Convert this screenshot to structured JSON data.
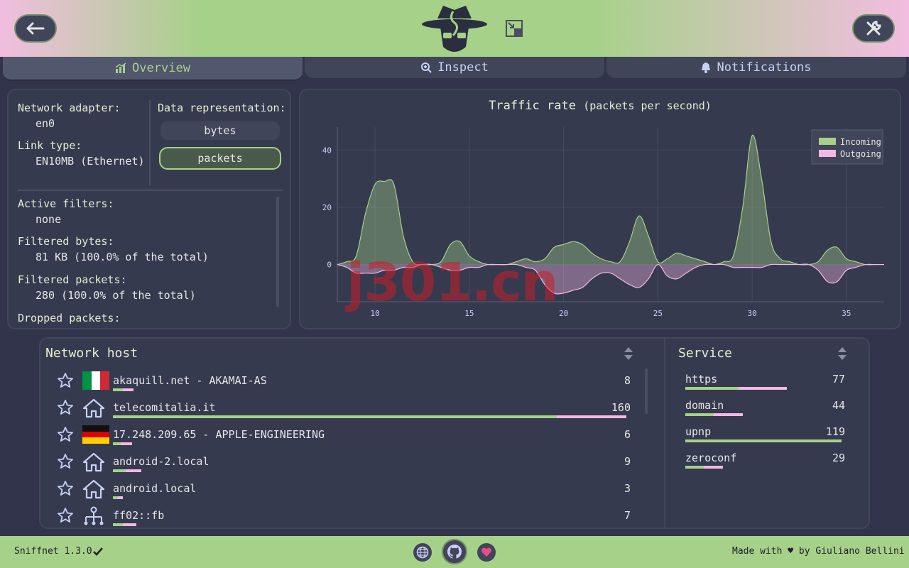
{
  "tabs": [
    {
      "label": "Overview",
      "active": true
    },
    {
      "label": "Inspect",
      "active": false
    },
    {
      "label": "Notifications",
      "active": false
    }
  ],
  "info": {
    "adapter_label": "Network adapter:",
    "adapter_value": "en0",
    "link_label": "Link type:",
    "link_value": "EN10MB (Ethernet)",
    "rep_label": "Data representation:",
    "rep_options": [
      "bytes",
      "packets"
    ],
    "rep_selected": "packets",
    "filters_label": "Active filters:",
    "filters_value": "none",
    "fbytes_label": "Filtered bytes:",
    "fbytes_value": "81 KB (100.0% of the total)",
    "fpackets_label": "Filtered packets:",
    "fpackets_value": "280 (100.0% of the total)",
    "dropped_label": "Dropped packets:"
  },
  "chart_title": "Traffic rate",
  "chart_subtitle": "(packets per second)",
  "chart_data": {
    "type": "area",
    "title": "Traffic rate (packets per second)",
    "x_ticks": [
      10,
      15,
      20,
      25,
      30,
      35
    ],
    "y_ticks": [
      0,
      20,
      40
    ],
    "xlim": [
      8,
      37
    ],
    "ylim": [
      -13,
      48
    ],
    "legend_position": "top-right",
    "series": [
      {
        "name": "Incoming",
        "color": "#a6d189",
        "x": [
          8,
          8.5,
          9,
          9.5,
          10,
          10.5,
          11,
          11.5,
          12,
          12.5,
          13,
          13.5,
          14,
          14.5,
          15,
          15.5,
          16,
          16.5,
          17,
          17.5,
          18,
          18.5,
          19,
          19.5,
          20,
          20.5,
          21,
          21.5,
          22,
          22.5,
          23,
          23.5,
          24,
          24.5,
          25,
          25.5,
          26,
          26.5,
          27,
          27.5,
          28,
          28.5,
          29,
          29.5,
          30,
          30.5,
          31,
          31.5,
          32,
          32.5,
          33,
          33.5,
          34,
          34.5,
          35,
          35.5,
          36,
          36.5,
          37
        ],
        "y": [
          0,
          1,
          3,
          18,
          28,
          29,
          28,
          10,
          1,
          0,
          0,
          1,
          7,
          8,
          3,
          1,
          0,
          0,
          0,
          1,
          2,
          1,
          2,
          6,
          7,
          8,
          7,
          4,
          2,
          1,
          1,
          8,
          17,
          10,
          1,
          2,
          4,
          3,
          2,
          1,
          0,
          1,
          3,
          20,
          45,
          30,
          8,
          2,
          1,
          0,
          0,
          1,
          5,
          6,
          2,
          1,
          0,
          0,
          0
        ]
      },
      {
        "name": "Outgoing",
        "color": "#f4b8e4",
        "x": [
          8,
          8.5,
          9,
          9.5,
          10,
          10.5,
          11,
          11.5,
          12,
          12.5,
          13,
          13.5,
          14,
          14.5,
          15,
          15.5,
          16,
          16.5,
          17,
          17.5,
          18,
          18.5,
          19,
          19.5,
          20,
          20.5,
          21,
          21.5,
          22,
          22.5,
          23,
          23.5,
          24,
          24.5,
          25,
          25.5,
          26,
          26.5,
          27,
          27.5,
          28,
          28.5,
          29,
          29.5,
          30,
          30.5,
          31,
          31.5,
          32,
          32.5,
          33,
          33.5,
          34,
          34.5,
          35,
          35.5,
          36,
          36.5,
          37
        ],
        "y": [
          0,
          -1,
          -3,
          -3,
          -3,
          -2,
          -2,
          -1,
          -1,
          0,
          0,
          -1,
          -2,
          -2,
          -1,
          -1,
          0,
          0,
          0,
          0,
          -1,
          -2,
          -7,
          -10,
          -10,
          -9,
          -8,
          -5,
          -3,
          -3,
          -5,
          -7,
          -8,
          -5,
          0,
          -4,
          -5,
          -3,
          -1,
          0,
          0,
          0,
          -1,
          -1,
          -1,
          -1,
          0,
          0,
          0,
          0,
          0,
          -2,
          -6,
          -6,
          -2,
          -1,
          0,
          0,
          0
        ]
      }
    ]
  },
  "hosts_title": "Network host",
  "hosts": [
    {
      "name": "akaquill.net - AKAMAI-AS",
      "count": "8",
      "icon": "flag-italy",
      "in_frac": 0.02,
      "out_frac": 0.02
    },
    {
      "name": "telecomitalia.it",
      "count": "160",
      "icon": "home-icon",
      "in_frac": 0.865,
      "out_frac": 0.135
    },
    {
      "name": "17.248.209.65 - APPLE-ENGINEERING",
      "count": "6",
      "icon": "flag-germany",
      "in_frac": 0.015,
      "out_frac": 0.022
    },
    {
      "name": "android-2.local",
      "count": "9",
      "icon": "home-icon",
      "in_frac": 0.025,
      "out_frac": 0.03
    },
    {
      "name": "android.local",
      "count": "3",
      "icon": "home-icon",
      "in_frac": 0.01,
      "out_frac": 0.01
    },
    {
      "name": "ff02::fb",
      "count": "7",
      "icon": "network-icon",
      "in_frac": 0.02,
      "out_frac": 0.025
    }
  ],
  "services_title": "Service",
  "services": [
    {
      "name": "https",
      "count": "77",
      "in_frac": 0.34,
      "out_frac": 0.31
    },
    {
      "name": "domain",
      "count": "44",
      "in_frac": 0.18,
      "out_frac": 0.19
    },
    {
      "name": "upnp",
      "count": "119",
      "in_frac": 1.0,
      "out_frac": 0.0
    },
    {
      "name": "zeroconf",
      "count": "29",
      "in_frac": 0.12,
      "out_frac": 0.12
    }
  ],
  "footer": {
    "version": "Sniffnet 1.3.0",
    "credit": "Made with ♥ by Giuliano Bellini"
  },
  "colors": {
    "accent": "#a6d189",
    "outgoing": "#f4b8e4",
    "panel": "#363a4f",
    "background": "#31344a"
  }
}
